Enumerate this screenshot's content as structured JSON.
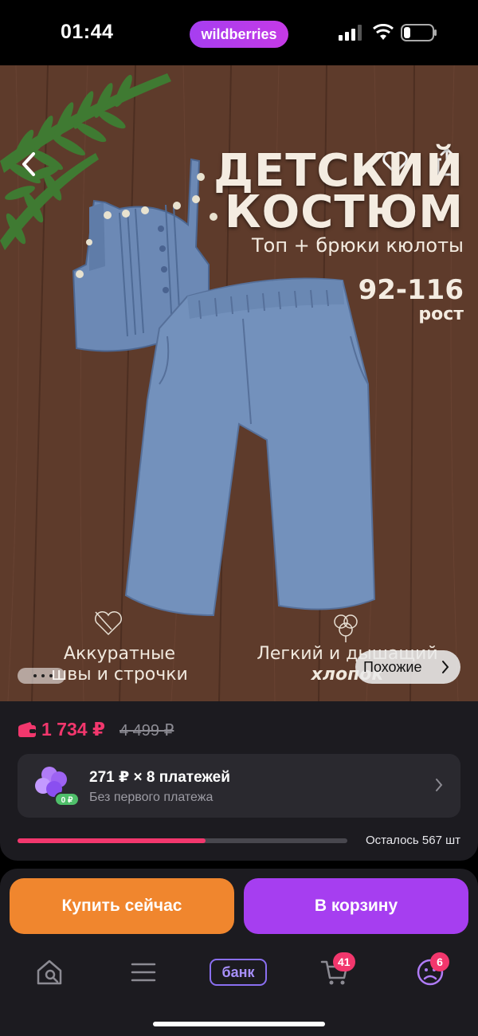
{
  "status_bar": {
    "time": "01:44",
    "brand": "wildberries"
  },
  "hero": {
    "title_line1": "ДЕТСКИЙ",
    "title_line2": "КОСТЮМ",
    "subtitle": "Топ + брюки кюлоты",
    "size_range": "92-116",
    "size_label": "рост",
    "feature1_line1": "Аккуратные",
    "feature1_line2": "швы и строчки",
    "feature2_line1": "Легкий и дышащий",
    "feature2_line2": "хлопок",
    "similar_label": "Похожие"
  },
  "price": {
    "current": "1 734 ₽",
    "old": "4 499 ₽"
  },
  "installment": {
    "title": "271 ₽ × 8 платежей",
    "subtitle": "Без первого платежа",
    "badge": "0 ₽"
  },
  "stock": {
    "text": "Осталось 567 шт",
    "fill_fraction": 0.57
  },
  "actions": {
    "buy_now": "Купить сейчас",
    "add_to_cart": "В корзину"
  },
  "nav": {
    "bank_label": "банк",
    "cart_badge": "41",
    "profile_badge": "6"
  },
  "colors": {
    "accent_pink": "#f2376d",
    "accent_purple": "#a63ef0",
    "accent_orange": "#f0862e"
  }
}
